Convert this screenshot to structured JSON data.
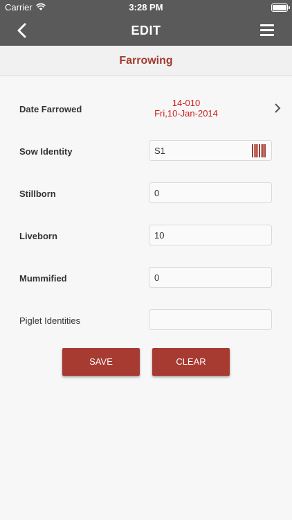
{
  "status_bar": {
    "carrier": "Carrier",
    "time": "3:28 PM"
  },
  "nav": {
    "title": "EDIT"
  },
  "section": {
    "title": "Farrowing"
  },
  "form": {
    "date_farrowed": {
      "label": "Date Farrowed",
      "code": "14-010",
      "date": "Fri,10-Jan-2014"
    },
    "sow_identity": {
      "label": "Sow Identity",
      "value": "S1"
    },
    "stillborn": {
      "label": "Stillborn",
      "value": "0"
    },
    "liveborn": {
      "label": "Liveborn",
      "value": "10"
    },
    "mummified": {
      "label": "Mummified",
      "value": "0"
    },
    "piglet_identities": {
      "label": "Piglet Identities",
      "value": ""
    }
  },
  "buttons": {
    "save": "SAVE",
    "clear": "CLEAR"
  },
  "colors": {
    "accent": "#a73a31",
    "nav_bg": "#5a5a5a",
    "date_text": "#cc1d1d"
  }
}
